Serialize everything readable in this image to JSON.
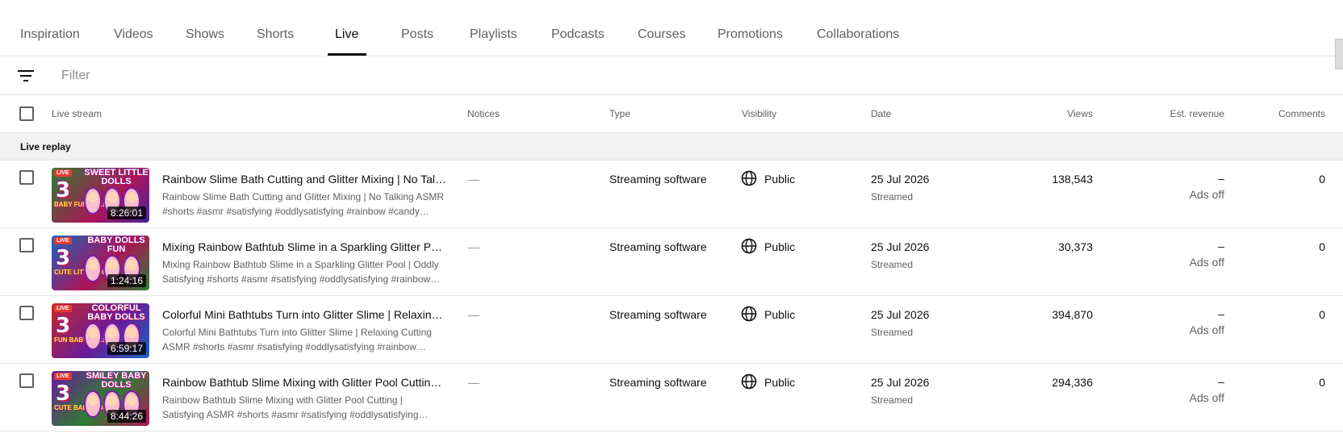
{
  "tabs": [
    {
      "label": "Inspiration"
    },
    {
      "label": "Videos"
    },
    {
      "label": "Shows"
    },
    {
      "label": "Shorts"
    },
    {
      "label": "Live",
      "active": true
    },
    {
      "label": "Posts"
    },
    {
      "label": "Playlists"
    },
    {
      "label": "Podcasts"
    },
    {
      "label": "Courses"
    },
    {
      "label": "Promotions"
    },
    {
      "label": "Collaborations"
    }
  ],
  "filter": {
    "placeholder": "Filter",
    "value": ""
  },
  "columns": {
    "live_stream": "Live stream",
    "notices": "Notices",
    "type": "Type",
    "visibility": "Visibility",
    "date": "Date",
    "views": "Views",
    "revenue": "Est. revenue",
    "comments": "Comments"
  },
  "section": {
    "label": "Live replay"
  },
  "rows": [
    {
      "thumb_top": "SWEET LITTLE DOLLS",
      "thumb_side": "BABY FUN DOLLS",
      "thumb_num": "3",
      "live_badge": "LIVE",
      "duration": "8:26:01",
      "title": "Rainbow Slime Bath Cutting and Glitter Mixing | No Talking ASMR",
      "description": "Rainbow Slime Bath Cutting and Glitter Mixing | No Talking ASMR #shorts #asmr #satisfying #oddlysatisfying #rainbow #candy…",
      "notice": "—",
      "type": "Streaming software",
      "visibility": "Public",
      "date": "25 Jul 2026",
      "date_sub": "Streamed",
      "views": "138,543",
      "revenue": "–",
      "revenue_sub": "Ads off",
      "comments": "0"
    },
    {
      "thumb_top": "BABY DOLLS FUN",
      "thumb_side": "CUTE LITTLE DOLLS",
      "thumb_num": "3",
      "live_badge": "LIVE",
      "duration": "1:24:16",
      "title": "Mixing Rainbow Bathtub Slime in a Sparkling Glitter Pool | Oddly Satisfying",
      "description": "Mixing Rainbow Bathtub Slime in a Sparkling Glitter Pool | Oddly Satisfying #shorts #asmr #satisfying #oddlysatisfying #rainbow…",
      "notice": "—",
      "type": "Streaming software",
      "visibility": "Public",
      "date": "25 Jul 2026",
      "date_sub": "Streamed",
      "views": "30,373",
      "revenue": "–",
      "revenue_sub": "Ads off",
      "comments": "0"
    },
    {
      "thumb_top": "COLORFUL BABY DOLLS",
      "thumb_side": "FUN BABY DOLLS",
      "thumb_num": "3",
      "live_badge": "LIVE",
      "duration": "6:59:17",
      "title": "Colorful Mini Bathtubs Turn into Glitter Slime | Relaxing Cutting ASMR",
      "description": "Colorful Mini Bathtubs Turn into Glitter Slime | Relaxing Cutting ASMR #shorts #asmr #satisfying #oddlysatisfying #rainbow…",
      "notice": "—",
      "type": "Streaming software",
      "visibility": "Public",
      "date": "25 Jul 2026",
      "date_sub": "Streamed",
      "views": "394,870",
      "revenue": "–",
      "revenue_sub": "Ads off",
      "comments": "0"
    },
    {
      "thumb_top": "SMILEY BABY DOLLS",
      "thumb_side": "CUTE BABY DOLLS",
      "thumb_num": "3",
      "live_badge": "LIVE",
      "duration": "8:44:26",
      "title": "Rainbow Bathtub Slime Mixing with Glitter Pool Cutting | Satisfying ASMR",
      "description": "Rainbow Bathtub Slime Mixing with Glitter Pool Cutting | Satisfying ASMR #shorts #asmr #satisfying #oddlysatisfying…",
      "notice": "—",
      "type": "Streaming software",
      "visibility": "Public",
      "date": "25 Jul 2026",
      "date_sub": "Streamed",
      "views": "294,336",
      "revenue": "–",
      "revenue_sub": "Ads off",
      "comments": "0"
    }
  ],
  "icons": {
    "filter": "filter-list-icon",
    "visibility": "globe-icon"
  },
  "colors": {
    "text_primary": "#0f0f0f",
    "text_secondary": "#606060",
    "divider": "#e5e5e5",
    "section_bg": "#f2f2f2"
  }
}
